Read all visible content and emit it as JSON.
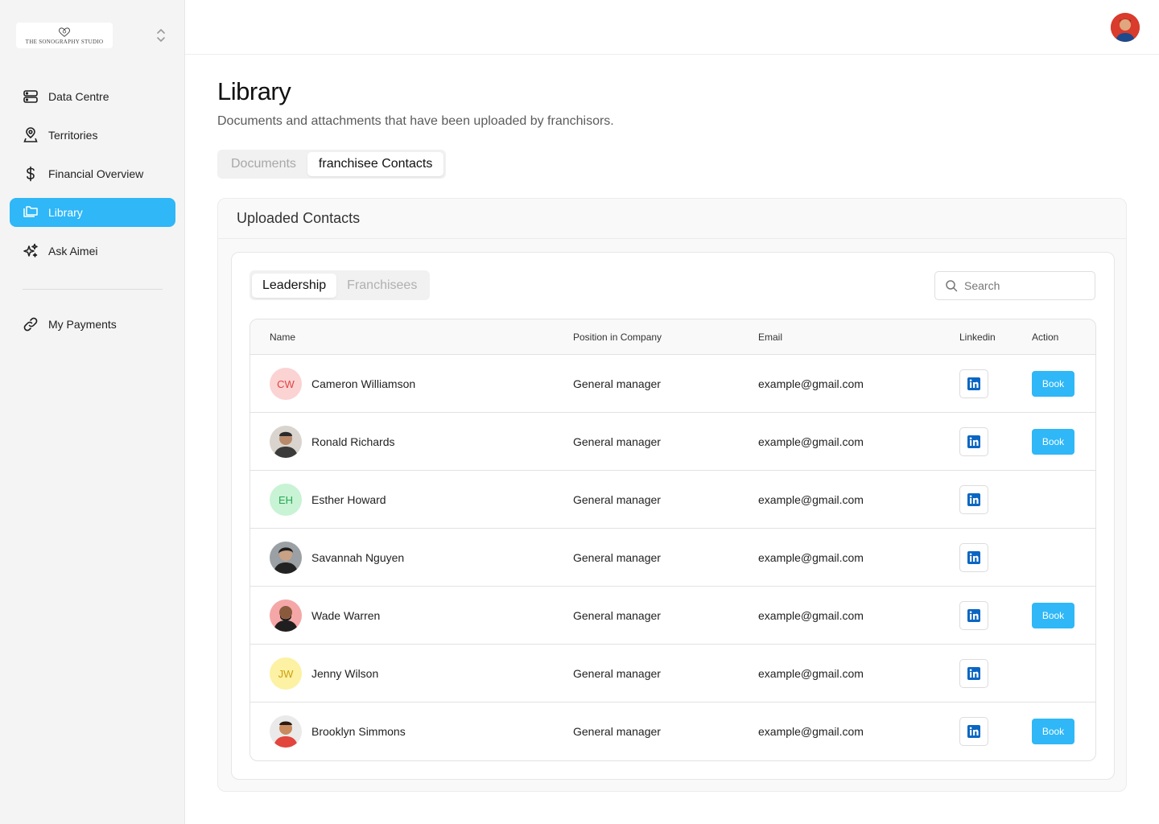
{
  "brand": {
    "name": "THE SONOGRAPHY STUDIO"
  },
  "sidebar": {
    "items": [
      {
        "label": "Data Centre",
        "icon": "server-icon"
      },
      {
        "label": "Territories",
        "icon": "location-pin-icon"
      },
      {
        "label": "Financial Overview",
        "icon": "dollar-icon"
      },
      {
        "label": "Library",
        "icon": "folder-icon",
        "active": true
      },
      {
        "label": "Ask Aimei",
        "icon": "sparkle-icon"
      }
    ],
    "secondary": [
      {
        "label": "My Payments",
        "icon": "link-icon"
      }
    ]
  },
  "header": {
    "title": "Library",
    "subtitle": "Documents and attachments that have been uploaded by franchisors.",
    "tabs": [
      {
        "label": "Documents",
        "active": false
      },
      {
        "label": "franchisee Contacts",
        "active": true
      }
    ]
  },
  "contacts": {
    "title": "Uploaded Contacts",
    "subtabs": [
      {
        "label": "Leadership",
        "active": true
      },
      {
        "label": "Franchisees",
        "active": false
      }
    ],
    "search_placeholder": "Search",
    "columns": {
      "name": "Name",
      "position": "Position in Company",
      "email": "Email",
      "linkedin": "Linkedin",
      "action": "Action"
    },
    "book_label": "Book",
    "rows": [
      {
        "name": "Cameron Williamson",
        "initials": "CW",
        "avatar_bg": "#fbd3d3",
        "avatar_fg": "#e24343",
        "position": "General manager",
        "email": "example@gmail.com",
        "book": true
      },
      {
        "name": "Ronald Richards",
        "photo": true,
        "position": "General manager",
        "email": "example@gmail.com",
        "book": true
      },
      {
        "name": "Esther Howard",
        "initials": "EH",
        "avatar_bg": "#c8f3d5",
        "avatar_fg": "#27a852",
        "position": "General manager",
        "email": "example@gmail.com",
        "book": false
      },
      {
        "name": "Savannah Nguyen",
        "photo": true,
        "position": "General manager",
        "email": "example@gmail.com",
        "book": false
      },
      {
        "name": "Wade Warren",
        "photo": true,
        "position": "General manager",
        "email": "example@gmail.com",
        "book": true
      },
      {
        "name": "Jenny Wilson",
        "initials": "JW",
        "avatar_bg": "#fdf1a3",
        "avatar_fg": "#c9a10e",
        "position": "General manager",
        "email": "example@gmail.com",
        "book": false
      },
      {
        "name": "Brooklyn Simmons",
        "photo": true,
        "position": "General manager",
        "email": "example@gmail.com",
        "book": true
      }
    ]
  },
  "colors": {
    "accent": "#2fb7f7",
    "linkedin": "#0a66c2"
  }
}
